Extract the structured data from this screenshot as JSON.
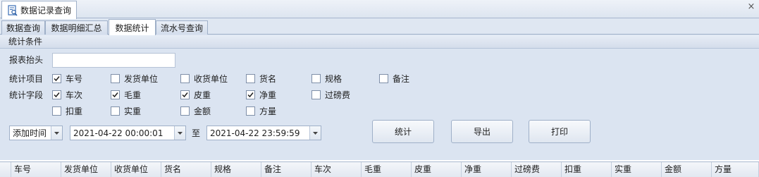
{
  "document_tab": {
    "title": "数据记录查询",
    "icon": "report-search-icon"
  },
  "tabs": [
    {
      "label": "数据查询",
      "active": false
    },
    {
      "label": "数据明细汇总",
      "active": false
    },
    {
      "label": "数据统计",
      "active": true
    },
    {
      "label": "流水号查询",
      "active": false
    }
  ],
  "group": {
    "title": "统计条件"
  },
  "report_header": {
    "label": "报表抬头",
    "value": ""
  },
  "stat_items": {
    "label": "统计项目",
    "options": [
      {
        "label": "车号",
        "checked": true
      },
      {
        "label": "发货单位",
        "checked": false
      },
      {
        "label": "收货单位",
        "checked": false
      },
      {
        "label": "货名",
        "checked": false
      },
      {
        "label": "规格",
        "checked": false
      },
      {
        "label": "备注",
        "checked": false
      }
    ]
  },
  "stat_fields": {
    "label": "统计字段",
    "options": [
      {
        "label": "车次",
        "checked": true
      },
      {
        "label": "毛重",
        "checked": true
      },
      {
        "label": "皮重",
        "checked": true
      },
      {
        "label": "净重",
        "checked": true
      },
      {
        "label": "过磅费",
        "checked": false
      },
      {
        "label": "扣重",
        "checked": false
      },
      {
        "label": "实重",
        "checked": false
      },
      {
        "label": "金额",
        "checked": false
      },
      {
        "label": "方量",
        "checked": false
      }
    ]
  },
  "time_filter": {
    "type": "添加时间",
    "start": "2021-04-22 00:00:01",
    "separator": "至",
    "end": "2021-04-22 23:59:59"
  },
  "buttons": {
    "stat": "统计",
    "export": "导出",
    "print": "打印"
  },
  "grid_columns": [
    "车号",
    "发货单位",
    "收货单位",
    "货名",
    "规格",
    "备注",
    "车次",
    "毛重",
    "皮重",
    "净重",
    "过磅费",
    "扣重",
    "实重",
    "金额",
    "方量"
  ],
  "colors": {
    "background": "#dbe4f1",
    "border": "#9fb0c8",
    "accent": "#3b6fb6"
  }
}
